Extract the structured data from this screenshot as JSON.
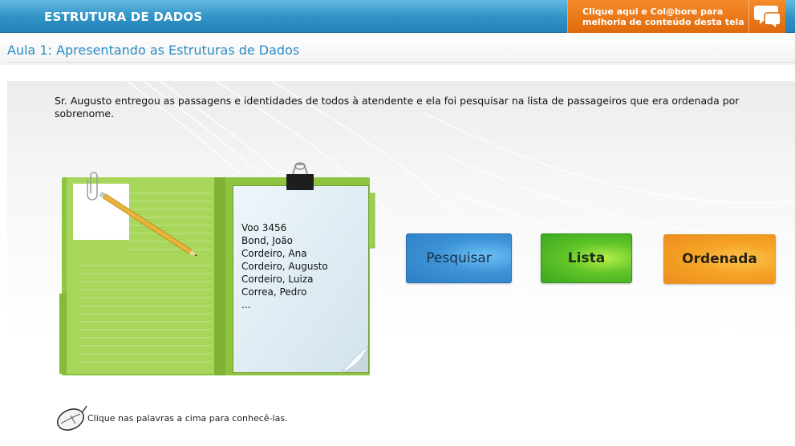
{
  "header": {
    "app_title": "ESTRUTURA DE DADOS",
    "collab_line1": "Clique aqui e Col@bore para",
    "collab_line2": "melhoria de conteúdo desta tela",
    "collab_icon": "chat-bubbles-icon"
  },
  "lesson": {
    "title": "Aula 1: Apresentando as Estruturas de Dados"
  },
  "content": {
    "intro": "Sr. Augusto entregou as passagens e identidades de todos à atendente e ela foi pesquisar na lista de passageiros que era ordenada por sobrenome.",
    "passenger_list": [
      "Voo 3456",
      "Bond, João",
      "Cordeiro, Ana",
      "Cordeiro, Augusto",
      "Cordeiro, Luiza",
      "Correa, Pedro",
      "..."
    ]
  },
  "buttons": {
    "pesquisar": "Pesquisar",
    "lista": "Lista",
    "ordenada": "Ordenada"
  },
  "hint": {
    "text": "Clique nas palavras a cima para conhecê-las.",
    "icon": "mouse-icon"
  },
  "colors": {
    "header_blue": "#2f92c5",
    "collab_orange": "#e8730f",
    "title_blue": "#2a8cc4",
    "folder_green": "#9ccf4e",
    "btn_blue": "#3c93d6",
    "btn_green": "#61c428",
    "btn_orange": "#f5a326"
  }
}
